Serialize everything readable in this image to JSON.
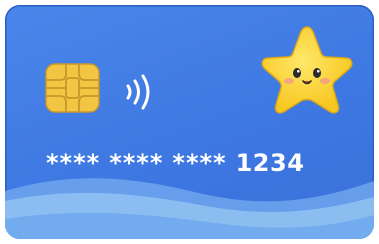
{
  "card": {
    "number_groups": [
      "****",
      "****",
      "****",
      "1234"
    ],
    "background_color": "#4a86ea",
    "wave_color": "#8fc0f2",
    "chip_color": "#f2c542",
    "star_color": "#ffd93b",
    "icons": {
      "chip": "chip-icon",
      "contactless": "contactless-icon",
      "mascot": "star-mascot-icon"
    }
  }
}
